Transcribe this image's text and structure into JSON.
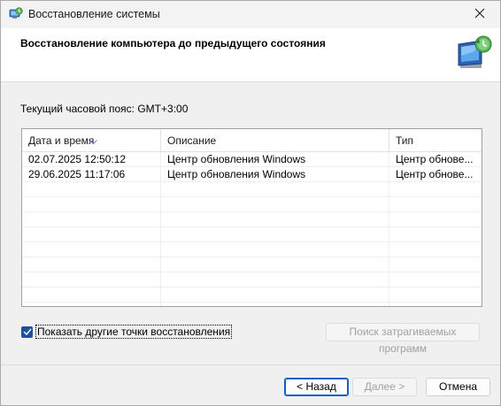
{
  "window": {
    "title": "Восстановление системы",
    "close_icon": "close-icon",
    "app_icon": "system-restore-icon"
  },
  "header": {
    "title": "Восстановление компьютера до предыдущего состояния",
    "icon": "system-restore-monitor-icon"
  },
  "timezone": "Текущий часовой пояс: GMT+3:00",
  "table": {
    "columns": [
      "Дата и время",
      "Описание",
      "Тип"
    ],
    "sort_column": "Дата и время",
    "sort_icon": "sort-down-icon",
    "rows": [
      [
        "02.07.2025 12:50:12",
        "Центр обновления Windows",
        "Центр обнове..."
      ],
      [
        "29.06.2025 11:17:06",
        "Центр обновления Windows",
        "Центр обнове..."
      ]
    ]
  },
  "show_more": {
    "label": "Показать другие точки восстановления",
    "checked": true
  },
  "buttons": {
    "scan": "Поиск затрагиваемых программ",
    "back": "< Назад",
    "next": "Далее >",
    "cancel": "Отмена"
  },
  "colors": {
    "accent": "#1f4fa0",
    "primary_border": "#0f5fc6"
  }
}
